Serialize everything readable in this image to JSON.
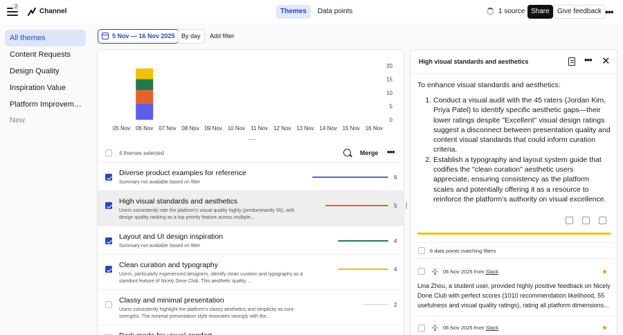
{
  "app": {
    "menu_badge": "2",
    "channel_name": "Channel"
  },
  "tabs": [
    {
      "label": "Themes",
      "active": true
    },
    {
      "label": "Data points",
      "active": false
    }
  ],
  "header": {
    "source_count": "1 source",
    "share_label": "Share",
    "feedback_label": "Give feedback"
  },
  "sidebar": {
    "items": [
      {
        "label": "All themes",
        "active": true
      },
      {
        "label": "Content Requests"
      },
      {
        "label": "Design Quality"
      },
      {
        "label": "Inspiration Value"
      },
      {
        "label": "Platform Improvements"
      },
      {
        "label": "New",
        "muted": true
      }
    ]
  },
  "filters": {
    "date_range": "5 Nov — 16 Nov 2025",
    "group_by": "By day",
    "add_filter": "Add filter"
  },
  "chart_data": {
    "type": "bar",
    "categories": [
      "05 Nov",
      "06 Nov",
      "07 Nov",
      "08 Nov",
      "09 Nov",
      "10 Nov",
      "11 Nov",
      "12 Nov",
      "13 Nov",
      "14 Nov",
      "15 Nov",
      "16 Nov"
    ],
    "stacked": true,
    "series": [
      {
        "color": "#5b5ee8",
        "values": [
          0,
          6,
          0,
          0,
          0,
          0,
          0,
          0,
          0,
          0,
          0,
          0
        ]
      },
      {
        "color": "#e8602a",
        "values": [
          0,
          5,
          0,
          0,
          0,
          0,
          0,
          0,
          0,
          0,
          0,
          0
        ]
      },
      {
        "color": "#1f7a4c",
        "values": [
          0,
          4,
          0,
          0,
          0,
          0,
          0,
          0,
          0,
          0,
          0,
          0
        ]
      },
      {
        "color": "#f2c200",
        "values": [
          0,
          4,
          0,
          0,
          0,
          0,
          0,
          0,
          0,
          0,
          0,
          0
        ]
      }
    ],
    "y_ticks": [
      "20",
      "15",
      "10",
      "5",
      "0"
    ],
    "ylim": [
      0,
      20
    ],
    "y_axis_side": "right"
  },
  "list": {
    "selected_count": "4 themes selected",
    "merge_label": "Merge",
    "rows": [
      {
        "title": "Diverse product examples for reference",
        "desc": "Summary not available based on filter",
        "count": "6",
        "color": "#5b5ee8",
        "checked": true,
        "selected": false
      },
      {
        "title": "High visual standards and aesthetics",
        "desc": "Users consistently rate the platform's visual quality highly (predominantly 55), with design quality ranking as a top priority feature across multiple...",
        "count": "5",
        "color": "#e8602a",
        "checked": true,
        "selected": true
      },
      {
        "title": "Layout and UI design inspiration",
        "desc": "Summary not available based on filter",
        "count": "4",
        "color": "#1f7a4c",
        "checked": true,
        "selected": false
      },
      {
        "title": "Clean curation and typography",
        "desc": "Users, particularly experienced designers, identify clean curation and typography as a standout feature of Nicely Done Club. This aesthetic quality ...",
        "count": "4",
        "color": "#f2c200",
        "checked": true,
        "selected": false
      },
      {
        "title": "Classy and minimal presentation",
        "desc": "Users consistently highlight the platform's classy aesthetics and simplicity as core strengths. The minimal presentation style resonates strongly with the...",
        "count": "2",
        "color": "#e4e4e4",
        "checked": false,
        "selected": false
      },
      {
        "title": "Dark mode for visual comfort",
        "desc": "",
        "count": "",
        "color": "#e4e4e4",
        "checked": false,
        "selected": false
      }
    ]
  },
  "detail": {
    "title": "High visual standards and aesthetics",
    "intro": "To enhance visual standards and aesthetics:",
    "points": [
      "Conduct a visual audit with the 45 raters (Jordan Kim, Priya Patel) to identify specific aesthetic gaps—their lower ratings despite \"Excellent\" visual design ratings suggest a disconnect between presentation quality and content visual standards that could inform curation criteria.",
      "Establish a typography and layout system guide that codifies the \"clean curation\" aesthetic users appreciate, ensuring consistency as the platform scales and potentially offering it as a resource to reinforce the platform's authority on visual excellence."
    ],
    "data_points_count": "6 data points matching filters",
    "data_points": [
      {
        "meta": "06 Nov 2025 from",
        "source": "Slack",
        "text": "Lina Zhou, a student user, provided highly positive feedback on Nicely Done Club with perfect scores (1010 recommendation likelihood, 55 usefulness and visual quality ratings), rating all platform dimensions..."
      },
      {
        "meta": "06 Nov 2025 from",
        "source": "Slack",
        "text": ""
      }
    ]
  }
}
